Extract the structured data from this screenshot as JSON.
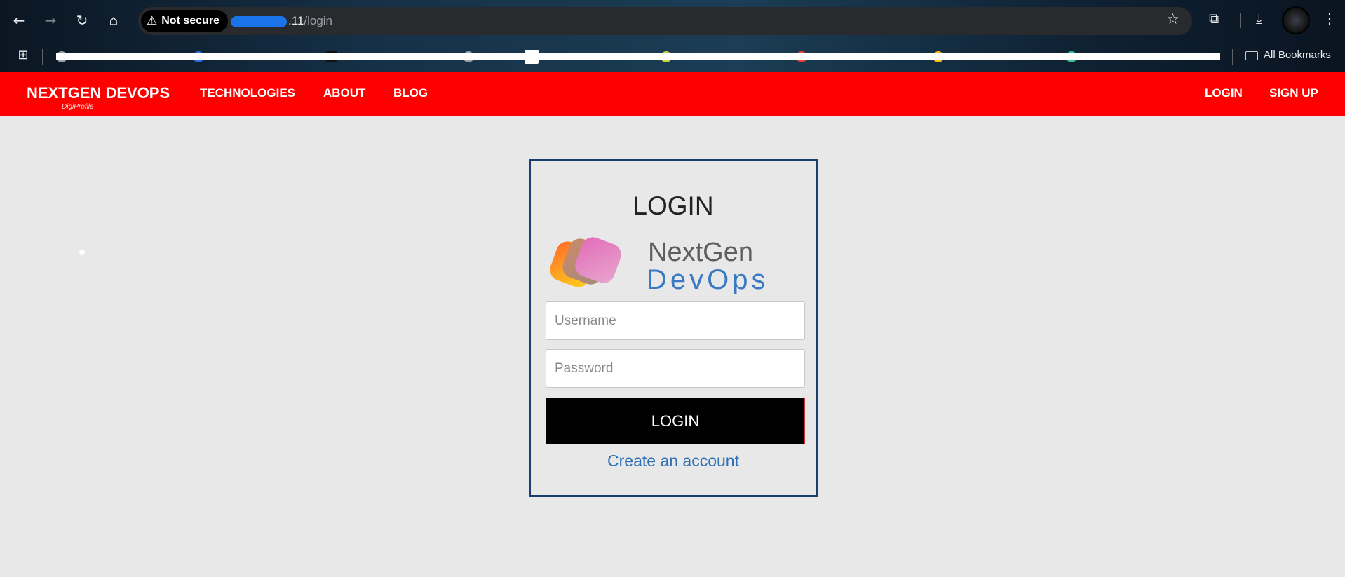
{
  "browser": {
    "security_label": "Not secure",
    "url_host_suffix": ".11",
    "url_path": "/login",
    "all_bookmarks_label": "All Bookmarks"
  },
  "site_nav": {
    "brand": "NEXTGEN DEVOPS",
    "brand_sub": "DigiProfile",
    "links": [
      "TECHNOLOGIES",
      "ABOUT",
      "BLOG"
    ],
    "login_label": "LOGIN",
    "signup_label": "SIGN UP"
  },
  "login_card": {
    "title": "LOGIN",
    "logo_line1": "NextGen",
    "logo_line2": "DevOps",
    "username_placeholder": "Username",
    "password_placeholder": "Password",
    "submit_label": "LOGIN",
    "create_account_label": "Create an account"
  },
  "colors": {
    "nav_bg": "#ff0000",
    "card_border": "#1a3f73",
    "link": "#2f6fb5",
    "button_bg": "#000000"
  }
}
